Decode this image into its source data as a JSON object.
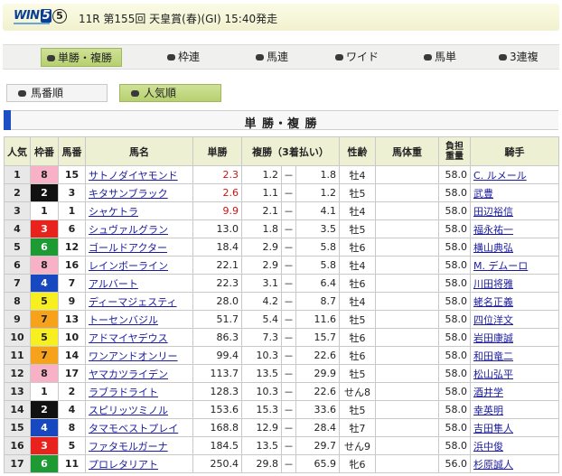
{
  "header": {
    "logo_text": "WIN",
    "logo_five": "5",
    "race_no_circle": "⑤",
    "race_info": "11R 第155回 天皇賞(春)(GI) 15:40発走"
  },
  "tabs": [
    "単勝・複勝",
    "枠連",
    "馬連",
    "ワイド",
    "馬単",
    "3連複"
  ],
  "sort_tabs": [
    "馬番順",
    "人気順"
  ],
  "section_title": "単 勝・複 勝",
  "columns": {
    "pop": "人気",
    "frame": "枠番",
    "horse_no": "馬番",
    "name": "馬名",
    "win": "単勝",
    "place": "複勝（3着払い）",
    "sexage": "性齢",
    "weight": "馬体重",
    "burden_a": "負担",
    "burden_b": "重量",
    "jockey": "騎手"
  },
  "frame_colors": {
    "1": {
      "bg": "#ffffff",
      "fg": "#222222"
    },
    "2": {
      "bg": "#111111",
      "fg": "#ffffff"
    },
    "3": {
      "bg": "#e8231d",
      "fg": "#ffffff"
    },
    "4": {
      "bg": "#1848c0",
      "fg": "#ffffff"
    },
    "5": {
      "bg": "#f8ef20",
      "fg": "#222222"
    },
    "6": {
      "bg": "#1e9a35",
      "fg": "#ffffff"
    },
    "7": {
      "bg": "#f6a21a",
      "fg": "#222222"
    },
    "8": {
      "bg": "#f7b2c7",
      "fg": "#222222"
    }
  },
  "rows": [
    {
      "pop": "1",
      "frame": "8",
      "no": "15",
      "name": "サトノダイヤモンド",
      "win": "2.3",
      "p1": "1.2",
      "dash": "－",
      "p2": "1.8",
      "sex": "牡4",
      "burden": "58.0",
      "jockey": "C. ルメール",
      "win_red": true
    },
    {
      "pop": "2",
      "frame": "2",
      "no": "3",
      "name": "キタサンブラック",
      "win": "2.6",
      "p1": "1.1",
      "dash": "－",
      "p2": "1.2",
      "sex": "牡5",
      "burden": "58.0",
      "jockey": "武豊",
      "win_red": true
    },
    {
      "pop": "3",
      "frame": "1",
      "no": "1",
      "name": "シャケトラ",
      "win": "9.9",
      "p1": "2.1",
      "dash": "－",
      "p2": "4.1",
      "sex": "牡4",
      "burden": "58.0",
      "jockey": "田辺裕信",
      "win_red": true
    },
    {
      "pop": "4",
      "frame": "3",
      "no": "6",
      "name": "シュヴァルグラン",
      "win": "13.0",
      "p1": "1.8",
      "dash": "－",
      "p2": "3.5",
      "sex": "牡5",
      "burden": "58.0",
      "jockey": "福永祐一",
      "win_red": false
    },
    {
      "pop": "5",
      "frame": "6",
      "no": "12",
      "name": "ゴールドアクター",
      "win": "18.4",
      "p1": "2.9",
      "dash": "－",
      "p2": "5.8",
      "sex": "牡6",
      "burden": "58.0",
      "jockey": "横山典弘",
      "win_red": false
    },
    {
      "pop": "6",
      "frame": "8",
      "no": "16",
      "name": "レインボーライン",
      "win": "22.1",
      "p1": "2.9",
      "dash": "－",
      "p2": "5.8",
      "sex": "牡4",
      "burden": "58.0",
      "jockey": "M. デムーロ",
      "win_red": false
    },
    {
      "pop": "7",
      "frame": "4",
      "no": "7",
      "name": "アルバート",
      "win": "22.3",
      "p1": "3.1",
      "dash": "－",
      "p2": "6.4",
      "sex": "牡6",
      "burden": "58.0",
      "jockey": "川田将雅",
      "win_red": false
    },
    {
      "pop": "8",
      "frame": "5",
      "no": "9",
      "name": "ディーマジェスティ",
      "win": "28.0",
      "p1": "4.2",
      "dash": "－",
      "p2": "8.7",
      "sex": "牡4",
      "burden": "58.0",
      "jockey": "蛯名正義",
      "win_red": false
    },
    {
      "pop": "9",
      "frame": "7",
      "no": "13",
      "name": "トーセンバジル",
      "win": "51.7",
      "p1": "5.4",
      "dash": "－",
      "p2": "11.6",
      "sex": "牡5",
      "burden": "58.0",
      "jockey": "四位洋文",
      "win_red": false
    },
    {
      "pop": "10",
      "frame": "5",
      "no": "10",
      "name": "アドマイヤデウス",
      "win": "86.3",
      "p1": "7.3",
      "dash": "－",
      "p2": "15.7",
      "sex": "牡6",
      "burden": "58.0",
      "jockey": "岩田康誠",
      "win_red": false
    },
    {
      "pop": "11",
      "frame": "7",
      "no": "14",
      "name": "ワンアンドオンリー",
      "win": "99.4",
      "p1": "10.3",
      "dash": "－",
      "p2": "22.6",
      "sex": "牡6",
      "burden": "58.0",
      "jockey": "和田竜二",
      "win_red": false
    },
    {
      "pop": "12",
      "frame": "8",
      "no": "17",
      "name": "ヤマカツライデン",
      "win": "113.7",
      "p1": "13.5",
      "dash": "－",
      "p2": "29.9",
      "sex": "牡5",
      "burden": "58.0",
      "jockey": "松山弘平",
      "win_red": false
    },
    {
      "pop": "13",
      "frame": "1",
      "no": "2",
      "name": "ラブラドライト",
      "win": "128.3",
      "p1": "10.3",
      "dash": "－",
      "p2": "22.6",
      "sex": "せん8",
      "burden": "58.0",
      "jockey": "酒井学",
      "win_red": false
    },
    {
      "pop": "14",
      "frame": "2",
      "no": "4",
      "name": "スピリッツミノル",
      "win": "153.6",
      "p1": "15.3",
      "dash": "－",
      "p2": "33.6",
      "sex": "牡5",
      "burden": "58.0",
      "jockey": "幸英明",
      "win_red": false
    },
    {
      "pop": "15",
      "frame": "4",
      "no": "8",
      "name": "タマモベストプレイ",
      "win": "168.8",
      "p1": "12.9",
      "dash": "－",
      "p2": "28.4",
      "sex": "牡7",
      "burden": "58.0",
      "jockey": "吉田隼人",
      "win_red": false
    },
    {
      "pop": "16",
      "frame": "3",
      "no": "5",
      "name": "ファタモルガーナ",
      "win": "184.5",
      "p1": "13.5",
      "dash": "－",
      "p2": "29.7",
      "sex": "せん9",
      "burden": "58.0",
      "jockey": "浜中俊",
      "win_red": false
    },
    {
      "pop": "17",
      "frame": "6",
      "no": "11",
      "name": "プロレタリアト",
      "win": "250.4",
      "p1": "29.8",
      "dash": "－",
      "p2": "65.9",
      "sex": "牝6",
      "burden": "56.0",
      "jockey": "杉原誠人",
      "win_red": false
    }
  ]
}
